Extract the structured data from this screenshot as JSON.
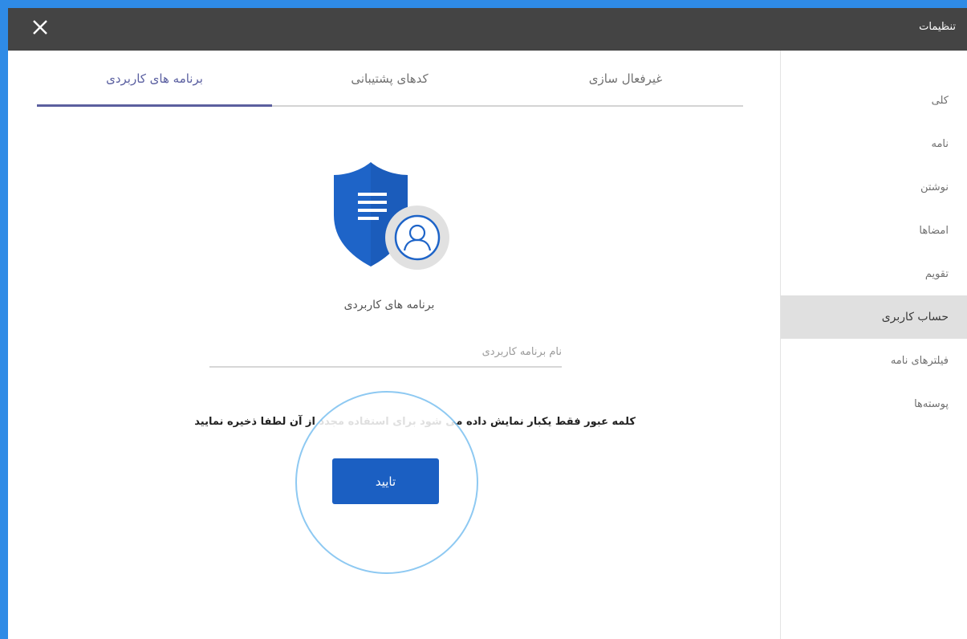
{
  "window": {
    "title": "تنظیمات",
    "close_icon": "close-icon"
  },
  "sidebar": {
    "items": [
      {
        "label": "کلی",
        "active": false
      },
      {
        "label": "نامه",
        "active": false
      },
      {
        "label": "نوشتن",
        "active": false
      },
      {
        "label": "امضاها",
        "active": false
      },
      {
        "label": "تقویم",
        "active": false
      },
      {
        "label": "حساب کاربری",
        "active": true
      },
      {
        "label": "فیلترهای نامه",
        "active": false
      },
      {
        "label": "پوسته‌ها",
        "active": false
      }
    ]
  },
  "tabs": [
    {
      "label": "غیرفعال سازی",
      "active": false
    },
    {
      "label": "کدهای پشتیبانی",
      "active": false
    },
    {
      "label": "برنامه های کاربردی",
      "active": true
    }
  ],
  "main": {
    "hero_icon": "shield-user-icon",
    "hero_label": "برنامه های کاربردی",
    "app_name_placeholder": "نام برنامه کاربردی",
    "notice": "کلمه عبور فقط یکبار نمایش داده می شود برای استفاده مجدد از آن لطفا ذخیره نمایید",
    "confirm_label": "تایید"
  },
  "colors": {
    "frame_border": "#2f8be6",
    "titlebar": "#444444",
    "active_tab": "#5b5f9e",
    "button": "#1b5fc2",
    "spotlight_ring": "#7cc1f0"
  }
}
